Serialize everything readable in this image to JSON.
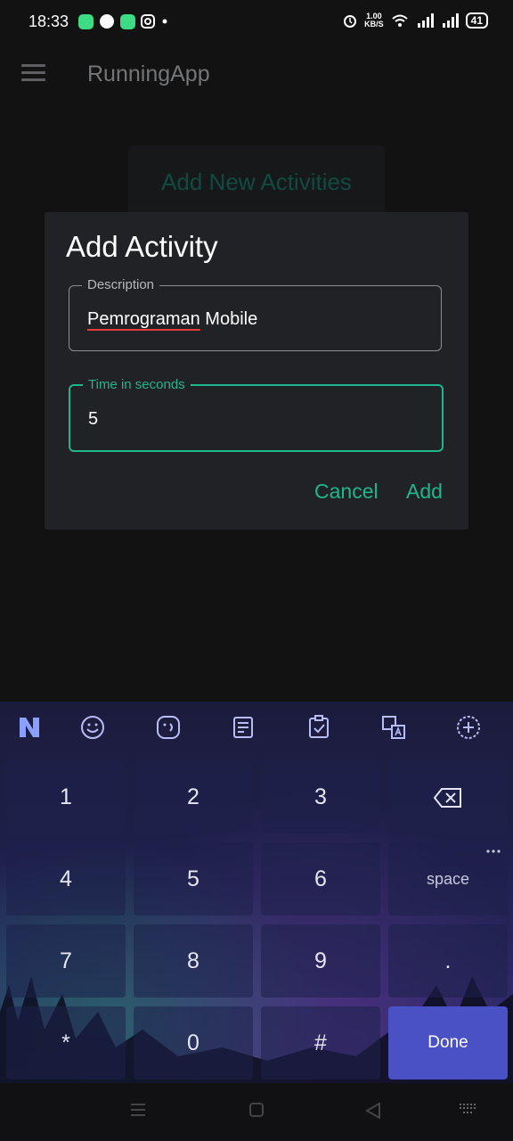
{
  "status_bar": {
    "time": "18:33",
    "net_speed_value": "1.00",
    "net_speed_unit": "KB/S",
    "battery": "41"
  },
  "app_bar": {
    "title": "RunningApp"
  },
  "background_button": {
    "label": "Add New Activities"
  },
  "dialog": {
    "title": "Add Activity",
    "description": {
      "label": "Description",
      "value_word1": "Pemrograman",
      "value_word2": "Mobile"
    },
    "time": {
      "label": "Time in seconds",
      "value": "5"
    },
    "cancel_label": "Cancel",
    "add_label": "Add"
  },
  "keyboard": {
    "keys": [
      "1",
      "2",
      "3",
      "4",
      "5",
      "6",
      "space",
      "7",
      "8",
      "9",
      ".",
      "*",
      "0",
      "#",
      "Done"
    ],
    "accent_color": "#4a51c4"
  },
  "colors": {
    "accent": "#1fb68e",
    "dialog_bg": "#202226"
  }
}
